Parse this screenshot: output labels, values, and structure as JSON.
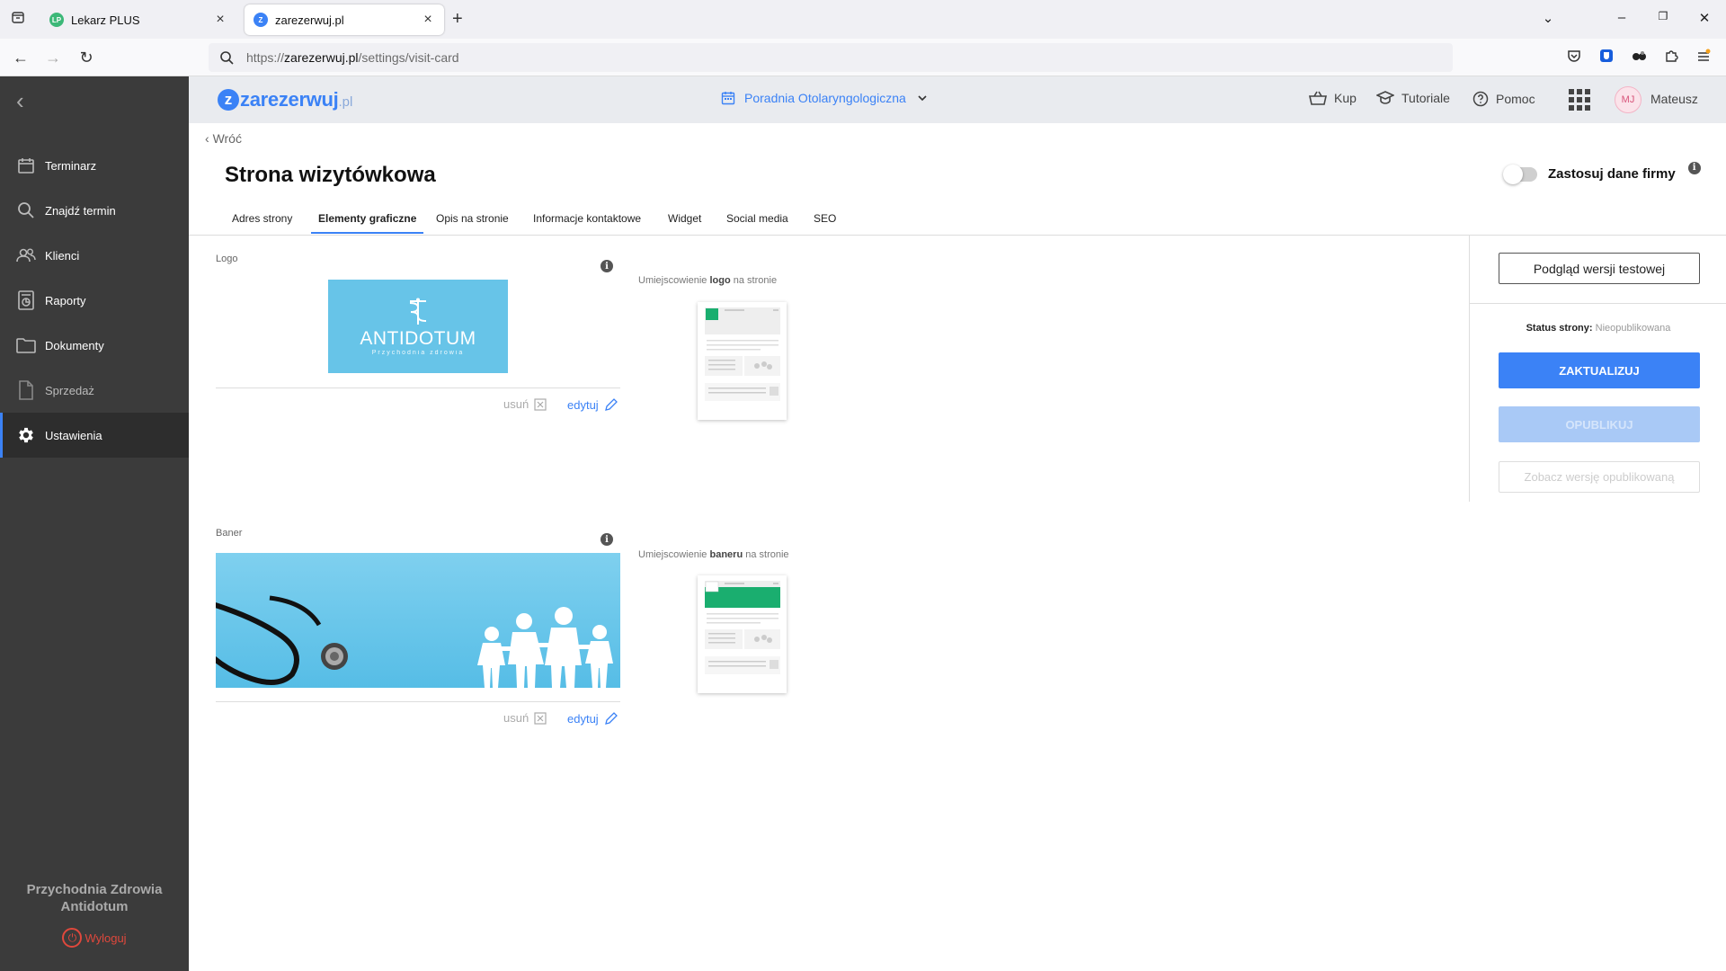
{
  "browser": {
    "tabs": [
      {
        "title": "Lekarz PLUS",
        "favicon": "LP",
        "favicon_color": "#3cb878"
      },
      {
        "title": "zarezerwuj.pl",
        "favicon": "Z",
        "favicon_color": "#3b82f6"
      }
    ],
    "url": {
      "scheme": "https://",
      "host": "zarezerwuj.pl",
      "path": "/settings/visit-card"
    }
  },
  "sidebar": {
    "items": [
      {
        "label": "Terminarz",
        "icon": "calendar-icon"
      },
      {
        "label": "Znajdź termin",
        "icon": "search-icon"
      },
      {
        "label": "Klienci",
        "icon": "users-icon"
      },
      {
        "label": "Raporty",
        "icon": "report-icon"
      },
      {
        "label": "Dokumenty",
        "icon": "folder-icon"
      },
      {
        "label": "Sprzedaż",
        "icon": "document-icon"
      },
      {
        "label": "Ustawienia",
        "icon": "gear-icon",
        "active": true
      }
    ],
    "org_line1": "Przychodnia Zdrowia",
    "org_line2": "Antidotum",
    "logout": "Wyloguj"
  },
  "header": {
    "brand_name": "zarezerwuj",
    "brand_tld": ".pl",
    "clinic": "Poradnia Otolaryngologiczna",
    "links": {
      "buy": "Kup",
      "tutorials": "Tutoriale",
      "help": "Pomoc"
    },
    "user_initials": "MJ",
    "user_name": "Mateusz"
  },
  "page": {
    "back": "Wróć",
    "title": "Strona wizytówkowa",
    "toggle_label": "Zastosuj dane firmy",
    "toggle_on": false,
    "tabs": [
      "Adres strony",
      "Elementy graficzne",
      "Opis na stronie",
      "Informacje kontaktowe",
      "Widget",
      "Social media",
      "SEO"
    ],
    "active_tab": "Elementy graficzne"
  },
  "logo_section": {
    "label": "Logo",
    "placement_prefix": "Umiejscowienie",
    "placement_bold": "logo",
    "placement_suffix": "na stronie",
    "logo_text": "ANTIDOTUM",
    "logo_subtext": "Przychodnia zdrowia",
    "remove": "usuń",
    "edit": "edytuj"
  },
  "banner_section": {
    "label": "Baner",
    "placement_prefix": "Umiejscowienie",
    "placement_bold": "baneru",
    "placement_suffix": "na stronie",
    "remove": "usuń",
    "edit": "edytuj"
  },
  "panel": {
    "preview_button": "Podgląd wersji testowej",
    "status_label": "Status strony:",
    "status_value": "Nieopublikowana",
    "update_button": "ZAKTUALIZUJ",
    "publish_button": "OPUBLIKUJ",
    "view_published_button": "Zobacz wersję opublikowaną"
  },
  "colors": {
    "accent": "#3b82f6",
    "sidebar_bg": "#3b3b3b",
    "logout": "#e0483c",
    "thumb_highlight": "#1aae6f"
  }
}
